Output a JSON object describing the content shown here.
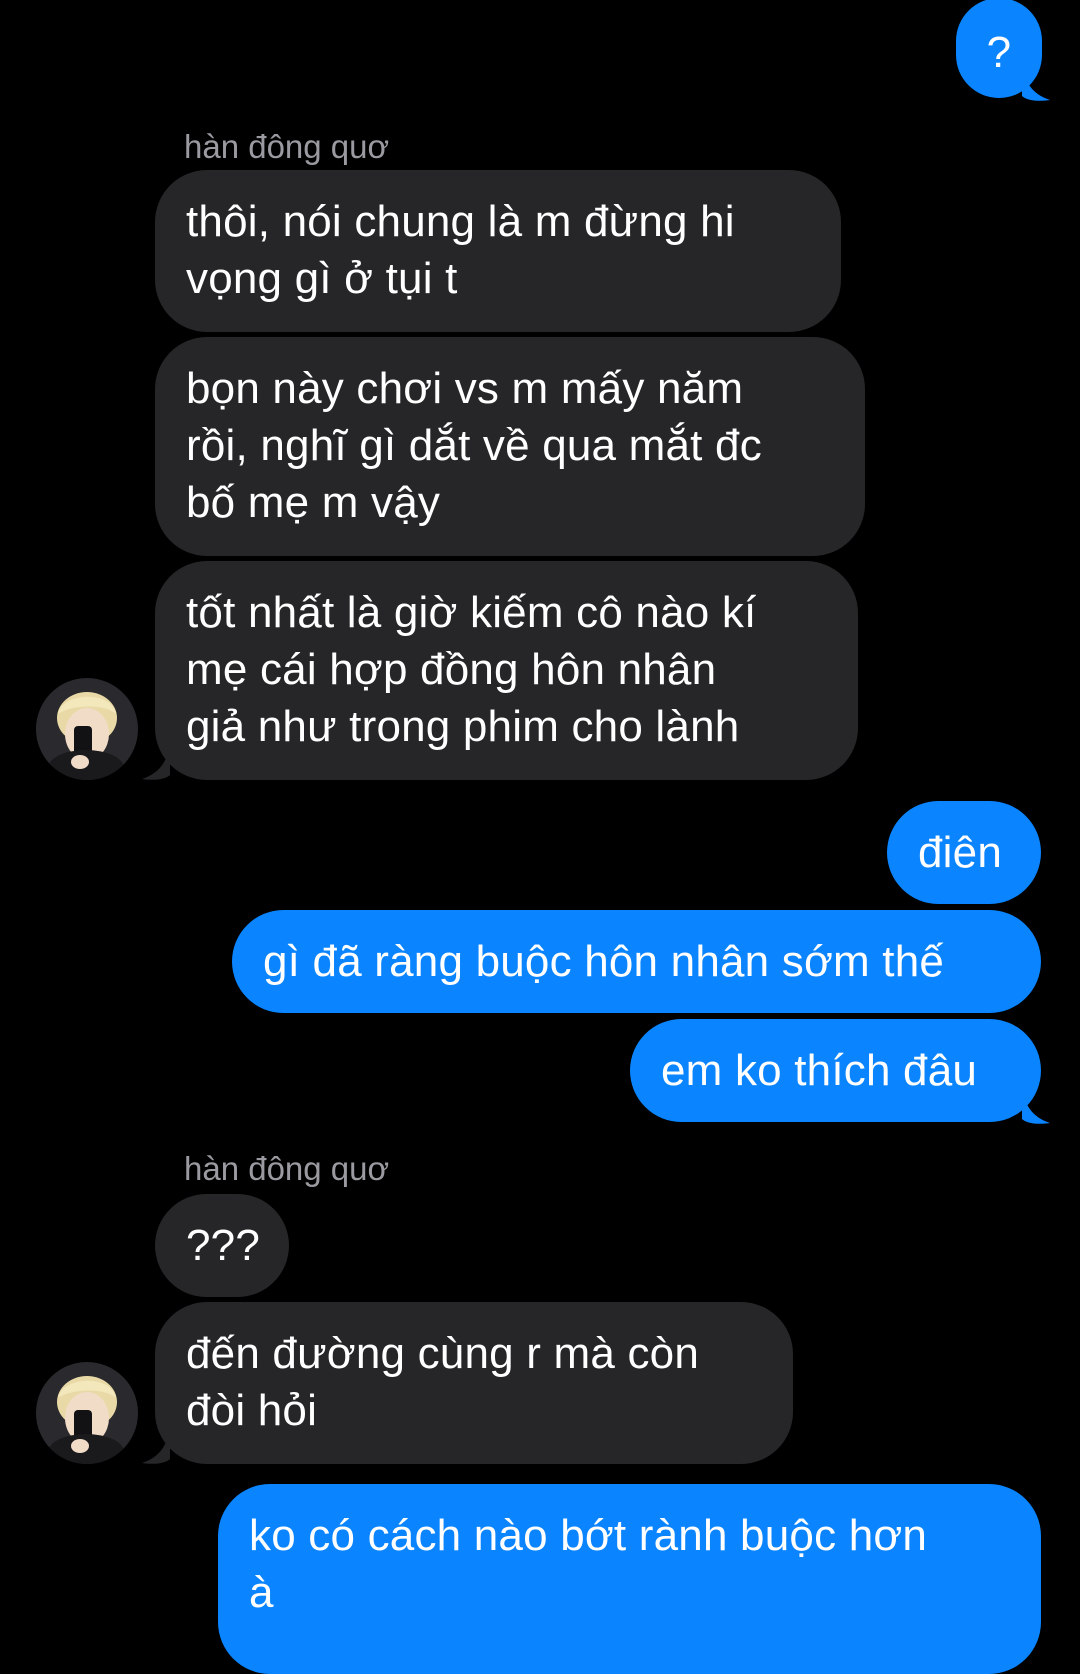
{
  "conversation": {
    "contact_name": "hàn đông quơ",
    "messages": [
      {
        "from": "me",
        "text": "?"
      },
      {
        "from": "contact",
        "text": "thôi, nói chung là m đừng hi\nvọng gì ở tụi t"
      },
      {
        "from": "contact",
        "text": "bọn này chơi vs m mấy năm\nrồi, nghĩ gì dắt về qua mắt đc\nbố mẹ m vậy"
      },
      {
        "from": "contact",
        "text": "tốt nhất là giờ kiếm cô nào kí\nmẹ cái hợp đồng hôn nhân\ngiả như trong phim cho lành"
      },
      {
        "from": "me",
        "text": "điên"
      },
      {
        "from": "me",
        "text": "gì đã ràng buộc hôn nhân sớm thế"
      },
      {
        "from": "me",
        "text": "em ko thích đâu"
      },
      {
        "from": "contact",
        "text": "???"
      },
      {
        "from": "contact",
        "text": "đến đường cùng r mà còn\nđòi hỏi"
      },
      {
        "from": "me",
        "text": "ko có cách nào bớt rành buộc hơn\nà"
      }
    ]
  },
  "colors": {
    "background": "#000000",
    "outgoing_bubble": "#0a84ff",
    "incoming_bubble": "#262628",
    "sender_name": "#9a9aa0"
  },
  "icons": {
    "avatar": "contact-avatar-photo"
  }
}
